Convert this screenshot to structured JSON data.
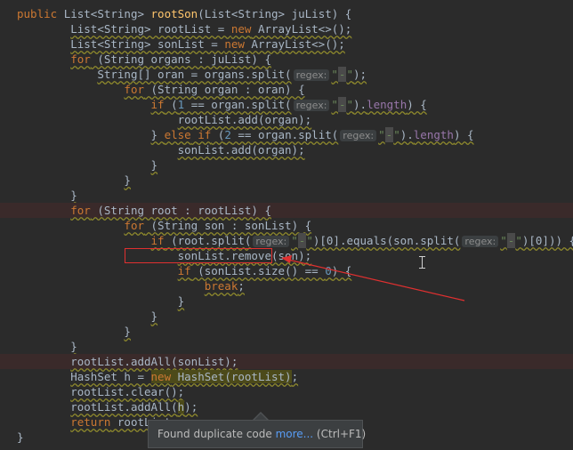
{
  "code": {
    "public": "public",
    "list_type": "List<String>",
    "method_name": "rootSon",
    "param_open": "(",
    "param_close": ") {",
    "param_type": "List<String>",
    "param_name": "juList",
    "rootlist_decl": "List<String> rootList = ",
    "sonlist_decl": "List<String> sonList = ",
    "new": "new",
    "arraylist_ctor": " ArrayList<>();",
    "for_kw": "for",
    "for1_rest": " (String organs : juList) {",
    "oran_decl": "String[] oran = organs.split(",
    "regex_hint": "regex:",
    "str_q": "\"",
    "str_dash": "-",
    "close_paren_semi": ");",
    "for2_rest": " (String organ : oran) {",
    "if_kw": "if",
    "if1_open": " (",
    "num_1": "1",
    "num_2": "2",
    "num_0": "0",
    "eq_split": " == organ.split(",
    "length_field": "length",
    "close_paren_dot": ").",
    "if_close": ") {",
    "rootlist_add": "rootList.add(organ);",
    "else_brace": "} ",
    "else_kw": "else",
    "sonlist_add": "sonList.add(organ);",
    "brace_close": "}",
    "for3_rest": " (String root : rootList) {",
    "for4_rest": " (String son : sonList) {",
    "if3_open": " (root.split(",
    "bracket0_equals": ")[0].equals(son.split(",
    "bracket0_close": ")[0])) {",
    "sonlist_remove": "sonList.remove(son);",
    "if4_open": " (sonList.size() == ",
    "break_kw": "break",
    "semi": ";",
    "addall_son": "rootList.addAll(sonList);",
    "hashset_decl": "HashSet h = ",
    "hashset_ctor": " HashSet(rootList)",
    "rootlist_clear": "rootList.clear();",
    "addall_h_open": "rootList.addAll(",
    "h_var": "h",
    "addall_h_close": ");",
    "return_kw": "return",
    "return_rest": " rootList;"
  },
  "tooltip": {
    "text": "Found duplicate code ",
    "link": "more...",
    "shortcut": " (Ctrl+F1)"
  },
  "colors": {
    "background": "#2b2b2b",
    "keyword": "#cc7832",
    "method": "#ffc66d",
    "number": "#6897bb",
    "string": "#6a8759",
    "annotation_red": "#e03030"
  }
}
